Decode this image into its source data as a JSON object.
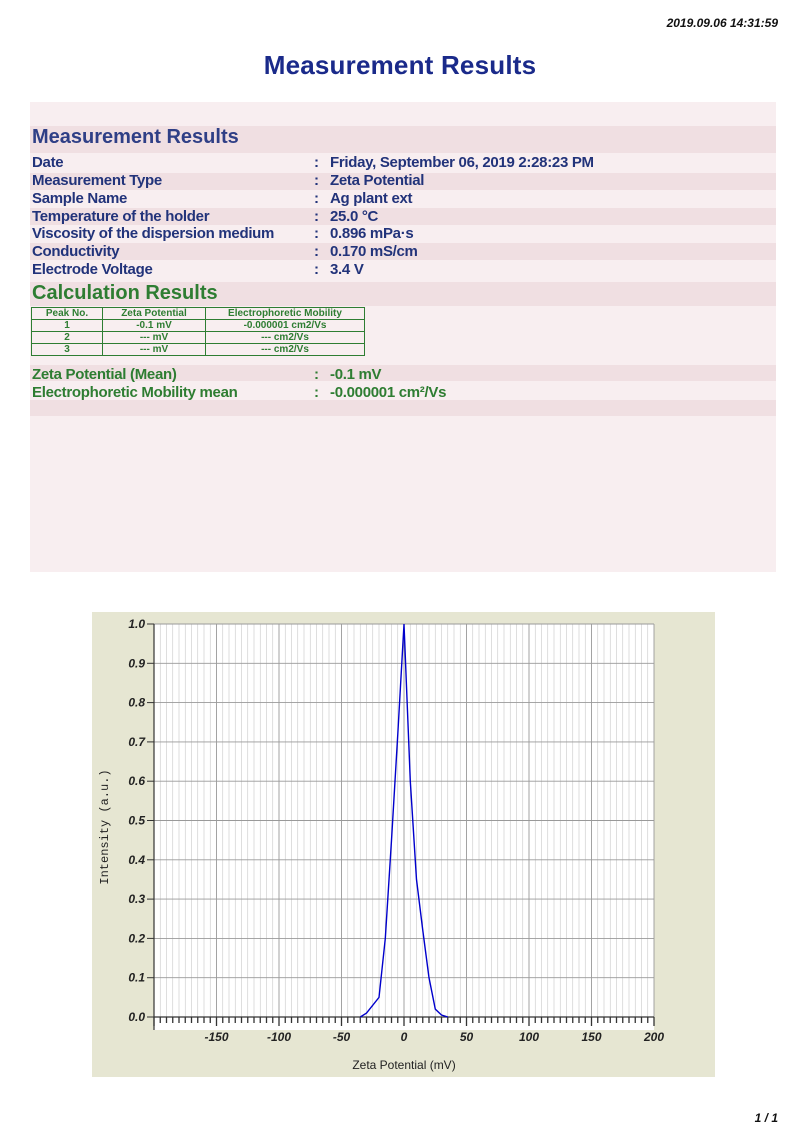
{
  "header": {
    "timestamp": "2019.09.06 14:31:59",
    "title": "Measurement Results",
    "page_number": "1 / 1"
  },
  "measurement": {
    "heading": "Measurement Results",
    "rows": [
      {
        "label": "Date",
        "value": "Friday, September 06, 2019 2:28:23 PM"
      },
      {
        "label": "Measurement Type",
        "value": "Zeta Potential"
      },
      {
        "label": "Sample Name",
        "value": "Ag plant ext"
      },
      {
        "label": "Temperature of the holder",
        "value": "25.0 °C"
      },
      {
        "label": "Viscosity of the dispersion medium",
        "value": "0.896 mPa·s"
      },
      {
        "label": "Conductivity",
        "value": "0.170 mS/cm"
      },
      {
        "label": "Electrode Voltage",
        "value": "3.4 V"
      }
    ],
    "separator": ":"
  },
  "calculation": {
    "heading": "Calculation Results",
    "table": {
      "headers": [
        "Peak No.",
        "Zeta Potential",
        "Electrophoretic Mobility"
      ],
      "rows": [
        [
          "1",
          "-0.1 mV",
          "-0.000001 cm2/Vs"
        ],
        [
          "2",
          "--- mV",
          "--- cm2/Vs"
        ],
        [
          "3",
          "--- mV",
          "--- cm2/Vs"
        ]
      ]
    },
    "summary": [
      {
        "label": "Zeta Potential (Mean)",
        "value": "-0.1 mV"
      },
      {
        "label": "Electrophoretic Mobility mean",
        "value": "-0.000001 cm²/Vs"
      }
    ]
  },
  "colors": {
    "heading_blue": "#2f3f86",
    "heading_green": "#2e7d32",
    "curve": "#0000cc",
    "chart_bg": "#e6e6d2",
    "report_bg": "#f8eef0"
  },
  "chart_data": {
    "type": "line",
    "title": "",
    "xlabel": "Zeta Potential (mV)",
    "ylabel": "Intensity (a.u.)",
    "xlim": [
      -200,
      200
    ],
    "ylim": [
      0,
      1.0
    ],
    "x_ticks": [
      -150,
      -100,
      -50,
      0,
      50,
      100,
      150,
      200
    ],
    "x_tick_labels": [
      "-150",
      "-100",
      "-50",
      "0",
      "50",
      "100",
      "150",
      "200"
    ],
    "y_ticks": [
      0,
      0.1,
      0.2,
      0.3,
      0.4,
      0.5,
      0.6,
      0.7,
      0.8,
      0.9,
      1.0
    ],
    "y_tick_labels": [
      "0.0",
      "0.1",
      "0.2",
      "0.3",
      "0.4",
      "0.5",
      "0.6",
      "0.7",
      "0.8",
      "0.9",
      "1.0"
    ],
    "grid": true,
    "legend": "none",
    "series": [
      {
        "x": [
          -35,
          -30,
          -20,
          -15,
          -10,
          -5,
          0,
          5,
          10,
          15,
          20,
          25,
          30,
          35
        ],
        "y": [
          0,
          0.01,
          0.05,
          0.2,
          0.45,
          0.72,
          1.0,
          0.6,
          0.35,
          0.22,
          0.1,
          0.02,
          0.005,
          0
        ]
      }
    ]
  }
}
